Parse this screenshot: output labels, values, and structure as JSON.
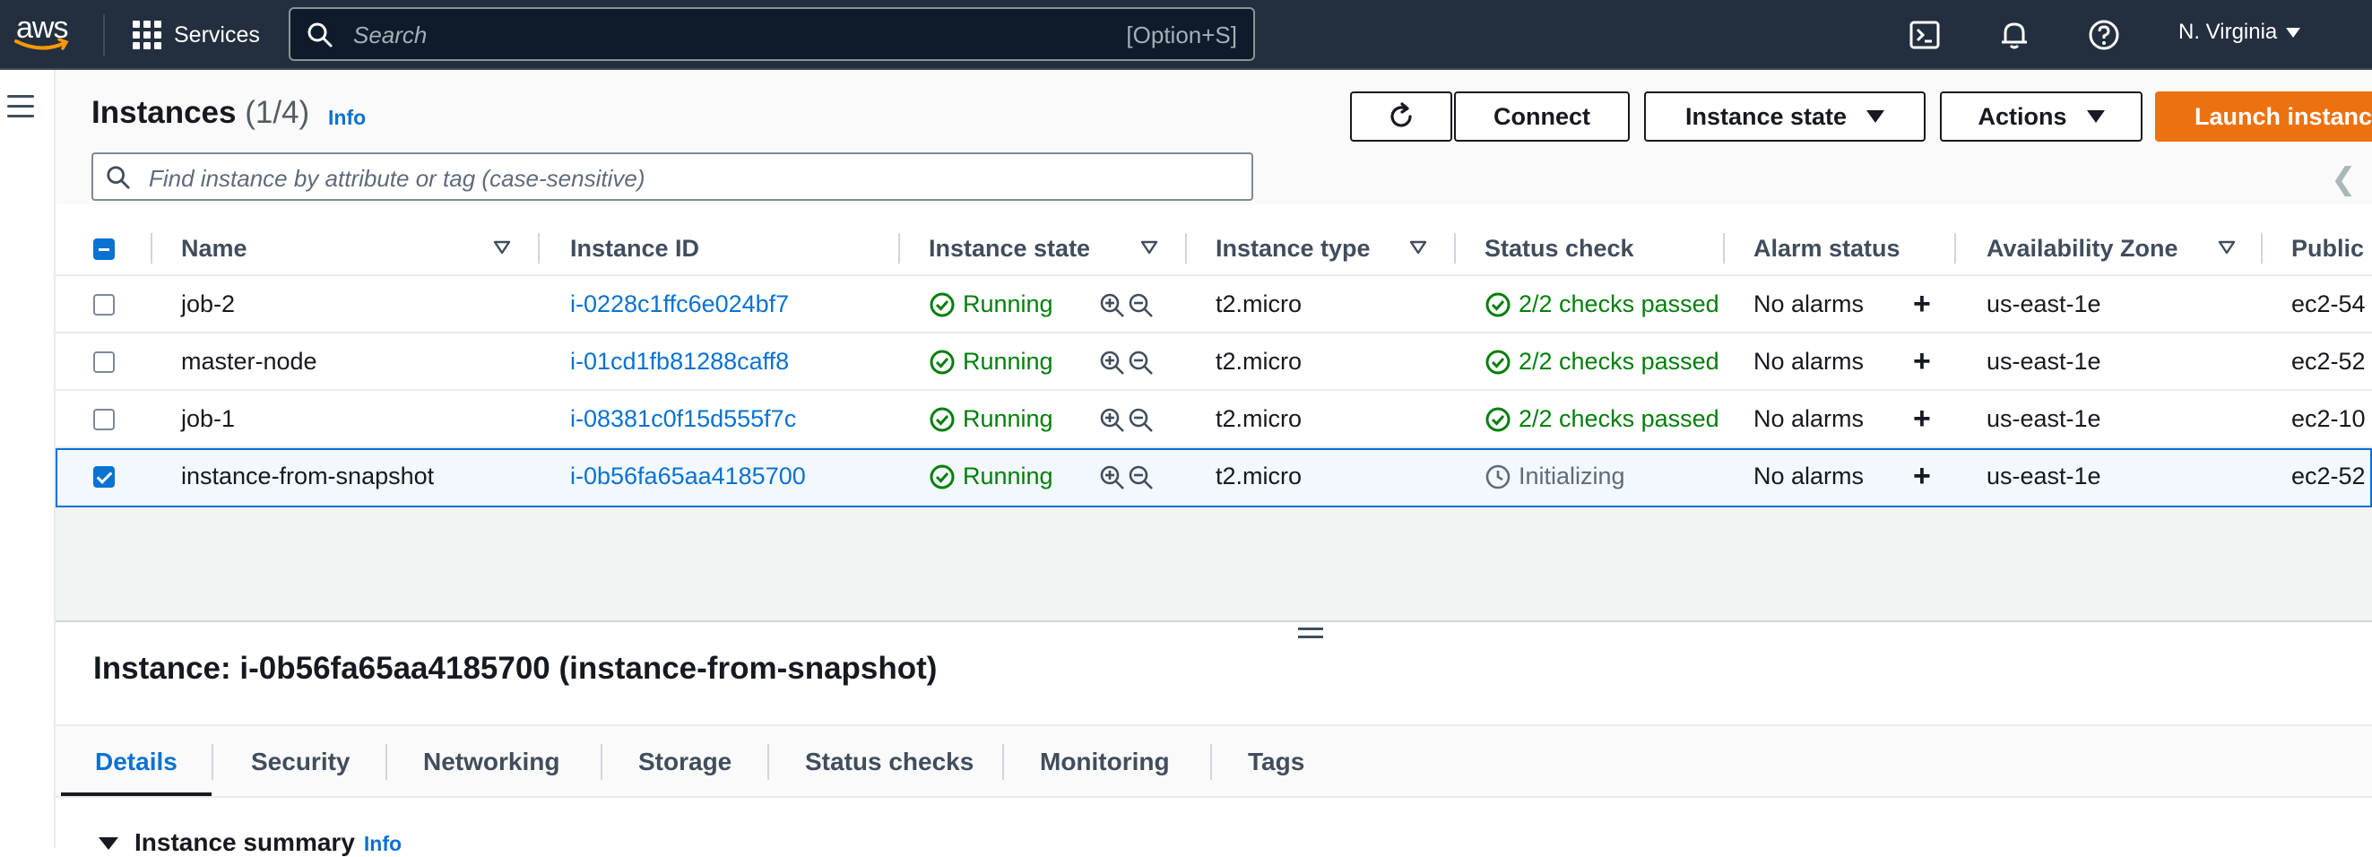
{
  "topnav": {
    "logo_text": "aws",
    "services_label": "Services",
    "search_placeholder": "Search",
    "search_shortcut": "[Option+S]",
    "region": "N. Virginia"
  },
  "header": {
    "title": "Instances",
    "count": "(1/4)",
    "info_label": "Info",
    "connect_label": "Connect",
    "instance_state_label": "Instance state",
    "actions_label": "Actions",
    "launch_label": "Launch instanc",
    "filter_placeholder": "Find instance by attribute or tag (case-sensitive)"
  },
  "table": {
    "columns": [
      "Name",
      "Instance ID",
      "Instance state",
      "Instance type",
      "Status check",
      "Alarm status",
      "Availability Zone",
      "Public"
    ],
    "rows": [
      {
        "name": "job-2",
        "id": "i-0228c1ffc6e024bf7",
        "state": "Running",
        "type": "t2.micro",
        "status": "2/2 checks passed",
        "status_ok": true,
        "alarm": "No alarms",
        "zone": "us-east-1e",
        "public": "ec2-54",
        "selected": false
      },
      {
        "name": "master-node",
        "id": "i-01cd1fb81288caff8",
        "state": "Running",
        "type": "t2.micro",
        "status": "2/2 checks passed",
        "status_ok": true,
        "alarm": "No alarms",
        "zone": "us-east-1e",
        "public": "ec2-52",
        "selected": false
      },
      {
        "name": "job-1",
        "id": "i-08381c0f15d555f7c",
        "state": "Running",
        "type": "t2.micro",
        "status": "2/2 checks passed",
        "status_ok": true,
        "alarm": "No alarms",
        "zone": "us-east-1e",
        "public": "ec2-10",
        "selected": false
      },
      {
        "name": "instance-from-snapshot",
        "id": "i-0b56fa65aa4185700",
        "state": "Running",
        "type": "t2.micro",
        "status": "Initializing",
        "status_ok": false,
        "alarm": "No alarms",
        "zone": "us-east-1e",
        "public": "ec2-52",
        "selected": true
      }
    ]
  },
  "detail": {
    "title": "Instance: i-0b56fa65aa4185700 (instance-from-snapshot)",
    "tabs": [
      "Details",
      "Security",
      "Networking",
      "Storage",
      "Status checks",
      "Monitoring",
      "Tags"
    ],
    "active_tab": "Details",
    "section_title": "Instance summary",
    "section_info": "Info"
  },
  "colors": {
    "nav_bg": "#232f3e",
    "accent": "#0972d3",
    "primary_button": "#ec7211",
    "success": "#037f0c"
  },
  "icons": [
    "grid-icon",
    "search-icon",
    "cloudshell-icon",
    "bell-icon",
    "help-icon",
    "refresh-icon",
    "check-circle-icon",
    "zoom-in-icon",
    "zoom-out-icon",
    "plus-icon",
    "clock-icon",
    "hamburger-icon",
    "chevron-left-icon"
  ]
}
